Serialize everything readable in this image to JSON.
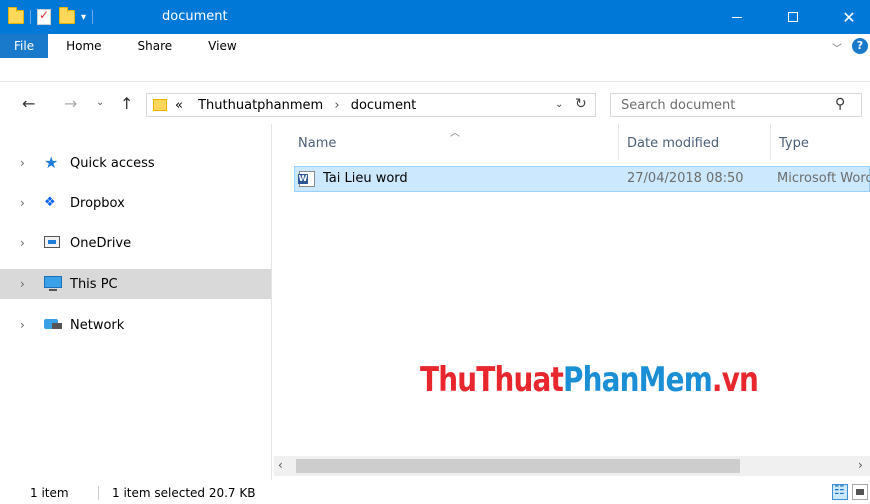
{
  "window": {
    "title": "document",
    "controls": {
      "minimize": "minimize-icon",
      "maximize": "maximize-icon",
      "close": "✕"
    }
  },
  "ribbon": {
    "tabs": [
      {
        "label": "File"
      },
      {
        "label": "Home"
      },
      {
        "label": "Share"
      },
      {
        "label": "View"
      }
    ],
    "help": "?"
  },
  "address": {
    "overflow": "«",
    "crumbs": [
      "Thuthuatphanmem",
      "document"
    ]
  },
  "search": {
    "placeholder": "Search document"
  },
  "nav": {
    "items": [
      {
        "label": "Quick access",
        "icon": "star-icon"
      },
      {
        "label": "Dropbox",
        "icon": "dropbox-icon"
      },
      {
        "label": "OneDrive",
        "icon": "onedrive-icon"
      },
      {
        "label": "This PC",
        "icon": "computer-icon",
        "selected": true
      },
      {
        "label": "Network",
        "icon": "network-icon"
      }
    ]
  },
  "columns": {
    "name": "Name",
    "date": "Date modified",
    "type": "Type"
  },
  "files": [
    {
      "name": "Tai Lieu word",
      "date": "27/04/2018 08:50",
      "type": "Microsoft Word"
    }
  ],
  "watermark": {
    "part1": "ThuThuat",
    "part2": "PhanMem",
    "part3": ".vn"
  },
  "status": {
    "count": "1 item",
    "selected": "1 item selected  20.7 KB"
  }
}
